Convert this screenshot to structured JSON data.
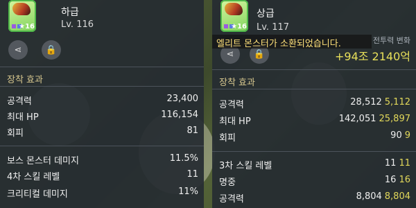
{
  "left": {
    "grade": "하급",
    "level": "Lv. 116",
    "star_count": "16",
    "section_title": "장착 효과",
    "stats": [
      {
        "name": "공격력",
        "value": "23,400"
      },
      {
        "name": "최대 HP",
        "value": "116,154"
      },
      {
        "name": "회피",
        "value": "81"
      },
      {
        "name": "보스 몬스터 데미지",
        "value": "11.5%"
      },
      {
        "name": "4차 스킬 레벨",
        "value": "11"
      },
      {
        "name": "크리티컬 데미지",
        "value": "11%"
      }
    ]
  },
  "right": {
    "grade": "상급",
    "level": "Lv. 117",
    "star_count": "16",
    "banner": "엘리트 몬스터가 소환되었습니다.",
    "power_label": "전투력 변화",
    "power_change": "+94조 2140억",
    "section_title": "장착 효과",
    "stats": [
      {
        "name": "공격력",
        "base": "28,512",
        "diff": "5,112"
      },
      {
        "name": "최대 HP",
        "base": "142,051",
        "diff": "25,897"
      },
      {
        "name": "회피",
        "base": "90",
        "diff": "9"
      },
      {
        "name": "3차 스킬 레벨",
        "base": "11",
        "diff": "11"
      },
      {
        "name": "명중",
        "base": "16",
        "diff": "16"
      },
      {
        "name": "공격력",
        "base": "8,804",
        "diff": "8,804"
      }
    ]
  },
  "icons": {
    "share": "share-icon",
    "lock": "lock-icon"
  },
  "colors": {
    "panel_bg": "#262c32",
    "diff_highlight": "#e2d85a",
    "section_title": "#d8c88f",
    "lock_red": "#e0343a"
  }
}
